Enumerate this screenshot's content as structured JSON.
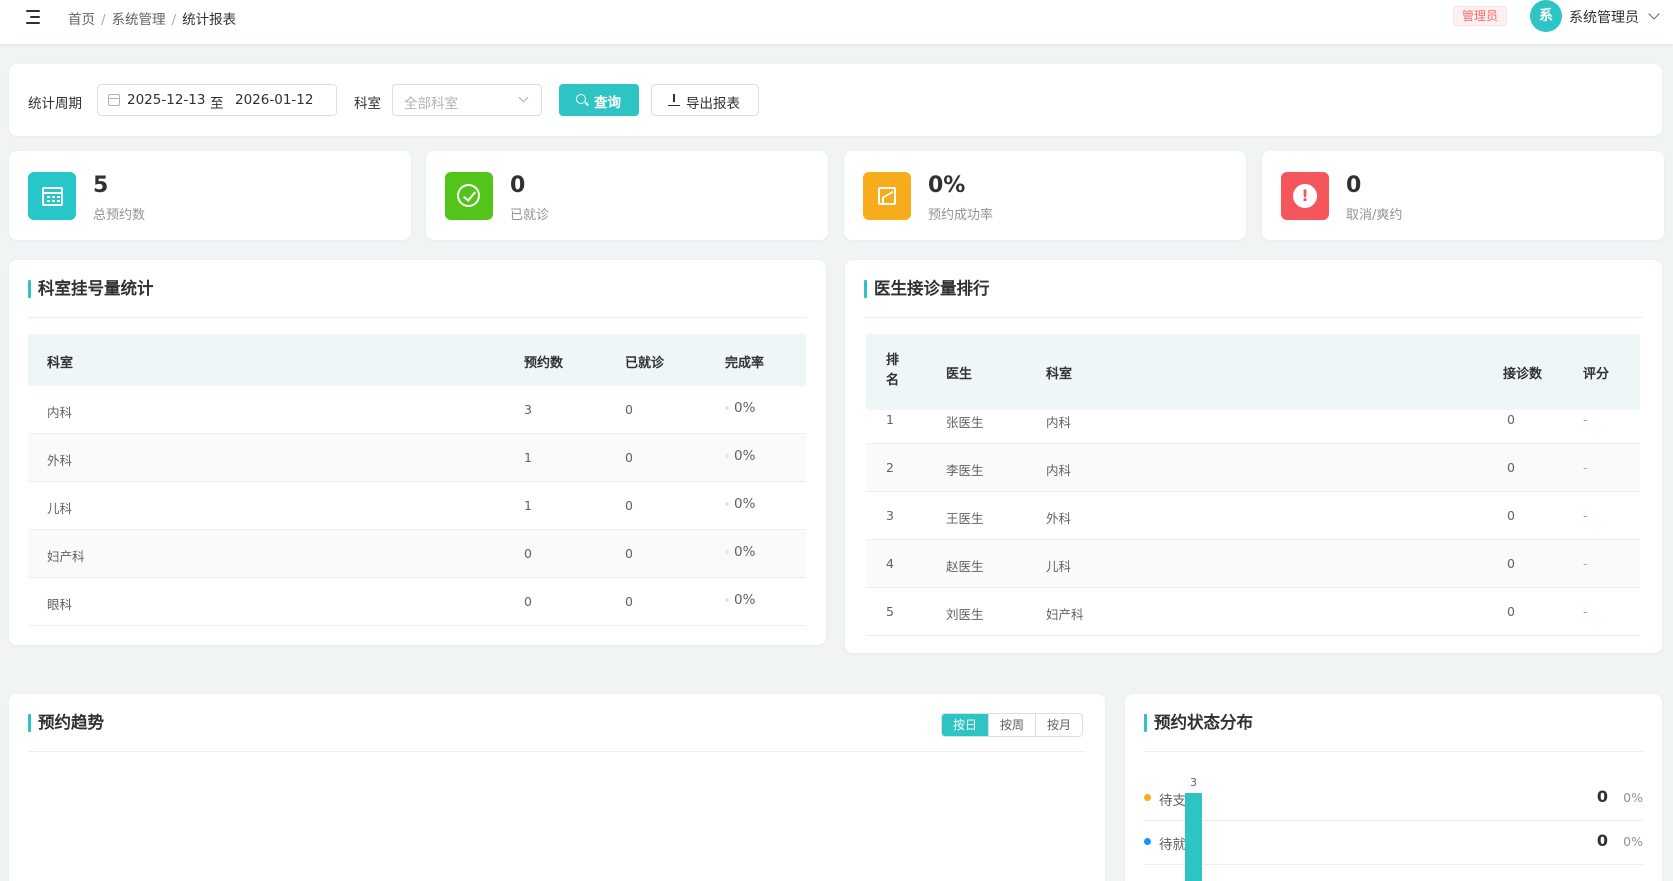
{
  "header": {
    "breadcrumb": [
      "首页",
      "系统管理",
      "统计报表"
    ],
    "role_tag": "管理员",
    "avatar_text": "系",
    "user_name": "系统管理员"
  },
  "filter": {
    "period_label": "统计周期",
    "date_start": "2025-12-13",
    "date_to": "至",
    "date_end": "2026-01-12",
    "dept_label": "科室",
    "dept_placeholder": "全部科室",
    "query_label": "查询",
    "export_label": "导出报表"
  },
  "stats": [
    {
      "value": "5",
      "label": "总预约数",
      "color": "#26c6c9",
      "icon": "calendar-icon"
    },
    {
      "value": "0",
      "label": "已就诊",
      "color": "#52c41a",
      "icon": "check-circle-icon"
    },
    {
      "value": "0%",
      "label": "预约成功率",
      "color": "#f7ac1b",
      "icon": "trend-chart-icon"
    },
    {
      "value": "0",
      "label": "取消/爽约",
      "color": "#f5565b",
      "icon": "alert-icon"
    }
  ],
  "dept_panel": {
    "title": "科室挂号量统计",
    "headers": [
      "科室",
      "预约数",
      "已就诊",
      "完成率"
    ],
    "rows": [
      [
        "内科",
        "3",
        "0",
        "0%"
      ],
      [
        "外科",
        "1",
        "0",
        "0%"
      ],
      [
        "儿科",
        "1",
        "0",
        "0%"
      ],
      [
        "妇产科",
        "0",
        "0",
        "0%"
      ],
      [
        "眼科",
        "0",
        "0",
        "0%"
      ]
    ]
  },
  "doctor_panel": {
    "title": "医生接诊量排行",
    "headers": [
      "排名",
      "医生",
      "科室",
      "接诊数",
      "评分"
    ],
    "rows": [
      [
        "1",
        "张医生",
        "内科",
        "0",
        "-"
      ],
      [
        "2",
        "李医生",
        "内科",
        "0",
        "-"
      ],
      [
        "3",
        "王医生",
        "外科",
        "0",
        "-"
      ],
      [
        "4",
        "赵医生",
        "儿科",
        "0",
        "-"
      ],
      [
        "5",
        "刘医生",
        "妇产科",
        "0",
        "-"
      ]
    ]
  },
  "trend_panel": {
    "title": "预约趋势",
    "segments": [
      "按日",
      "按周",
      "按月"
    ],
    "active_segment": "按日"
  },
  "status_panel": {
    "title": "预约状态分布",
    "items": [
      {
        "name": "待支付",
        "count": "0",
        "percent": "0%",
        "color": "#f7ac1b"
      },
      {
        "name": "待就诊",
        "count": "0",
        "percent": "0%",
        "color": "#1890ff"
      }
    ],
    "bar_value": "3"
  },
  "colors": {
    "accent": "#2ec4c4"
  }
}
